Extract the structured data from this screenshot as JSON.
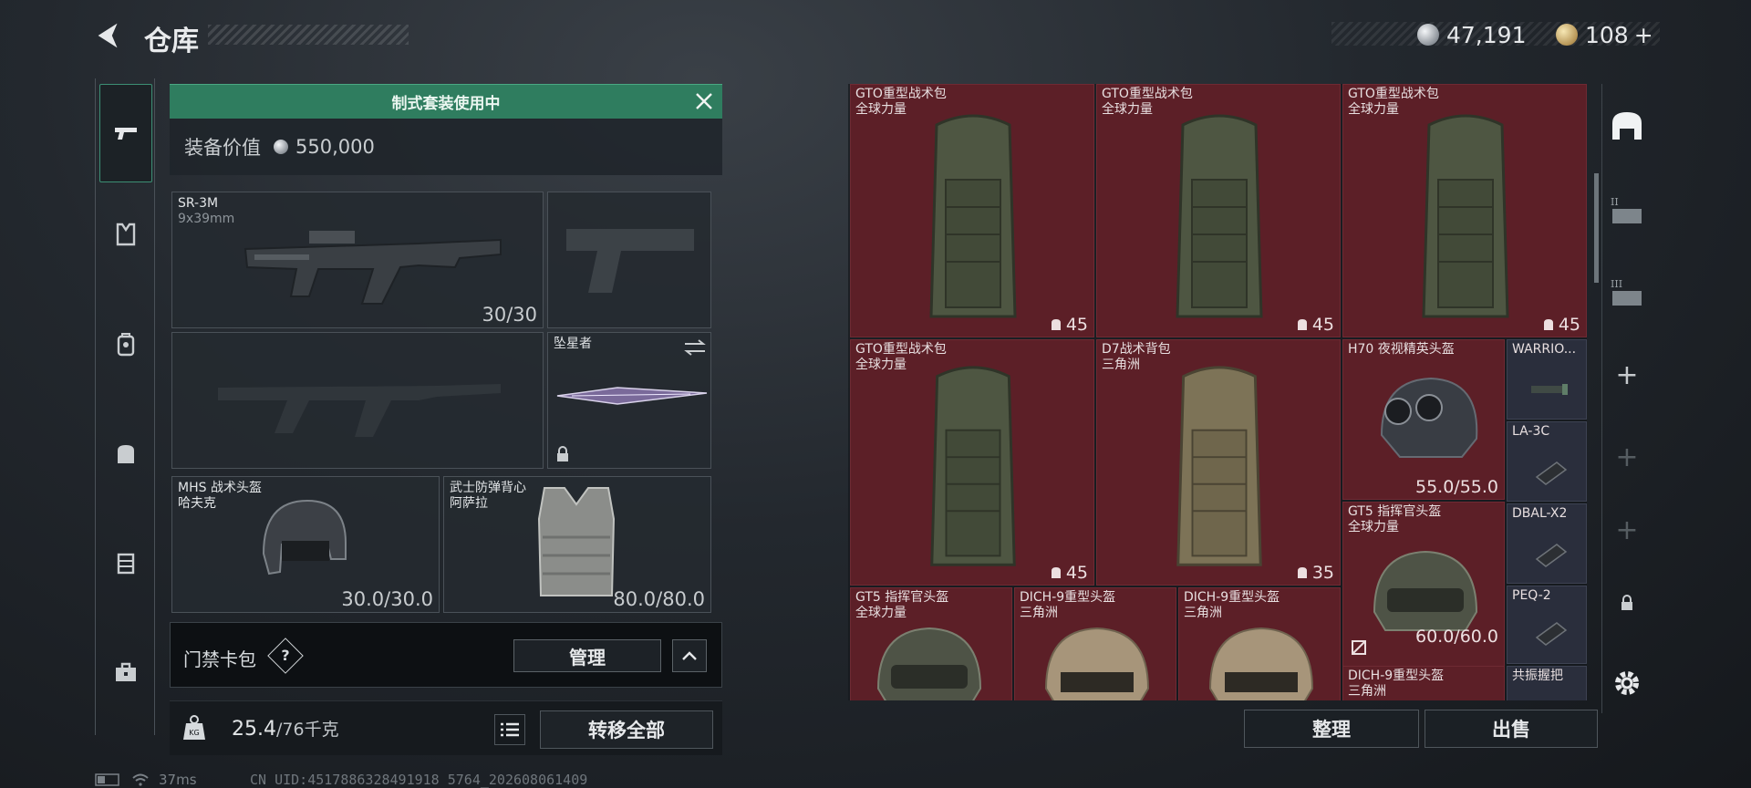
{
  "header": {
    "title": "仓库",
    "currency_silver": "47,191",
    "currency_gold": "108",
    "currency_add": "+"
  },
  "loadout": {
    "kit_banner": "制式套装使用中",
    "value_label": "装备价值",
    "value_amount": "550,000",
    "primary": {
      "name": "SR-3M",
      "ammo_type": "9x39mm",
      "ammo": "30/30"
    },
    "melee": {
      "name": "坠星者"
    },
    "helmet": {
      "name": "MHS 战术头盔",
      "rarity": "哈夫克",
      "durability": "30.0/30.0"
    },
    "armor": {
      "name": "武士防弹背心",
      "rarity": "阿萨拉",
      "durability": "80.0/80.0"
    },
    "keycard": {
      "label": "门禁卡包",
      "help": "?",
      "manage": "管理"
    },
    "weight": {
      "current": "25.4",
      "max": "/76千克"
    },
    "transfer_all": "转移全部"
  },
  "stash": {
    "items": [
      {
        "name": "GTO重型战术包",
        "sub": "全球力量",
        "count": "45"
      },
      {
        "name": "GTO重型战术包",
        "sub": "全球力量",
        "count": "45"
      },
      {
        "name": "GTO重型战术包",
        "sub": "全球力量",
        "count": "45"
      },
      {
        "name": "GTO重型战术包",
        "sub": "全球力量",
        "count": "45"
      },
      {
        "name": "D7战术背包",
        "sub": "三角洲",
        "count": "35"
      },
      {
        "name": "H70 夜视精英头盔",
        "sub": "",
        "durability": "55.0/55.0"
      },
      {
        "name": "GT5 指挥官头盔",
        "sub": "全球力量",
        "durability": "60.0/60.0"
      },
      {
        "name": "GT5 指挥官头盔",
        "sub": "全球力量"
      },
      {
        "name": "DICH-9重型头盔",
        "sub": "三角洲"
      },
      {
        "name": "DICH-9重型头盔",
        "sub": "三角洲"
      },
      {
        "name": "DICH-9重型头盔",
        "sub": "三角洲"
      }
    ],
    "attachments": [
      {
        "name": "WARRIO..."
      },
      {
        "name": "LA-3C"
      },
      {
        "name": "DBAL-X2"
      },
      {
        "name": "PEQ-2"
      },
      {
        "name": "共振握把"
      }
    ],
    "sort": "整理",
    "sell": "出售"
  },
  "right_tabs": [
    "II",
    "III",
    "+",
    "+",
    "+"
  ],
  "status": {
    "ping": "37ms",
    "uid": "CN UID:4517886328491918 5764_202608061409"
  }
}
